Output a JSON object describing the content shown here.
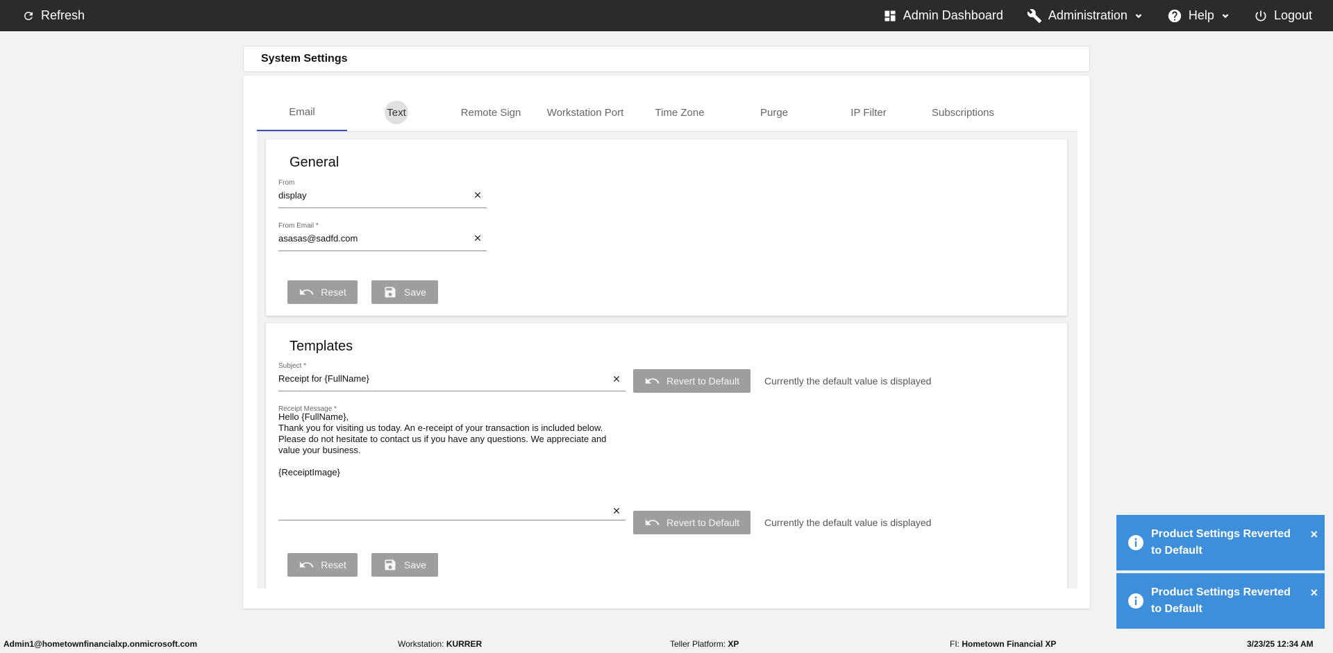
{
  "topbar": {
    "refresh_label": "Refresh",
    "admin_dashboard_label": "Admin Dashboard",
    "administration_label": "Administration",
    "help_label": "Help",
    "logout_label": "Logout"
  },
  "page_title": "System Settings",
  "tabs": [
    {
      "label": "Email"
    },
    {
      "label": "Text"
    },
    {
      "label": "Remote Sign"
    },
    {
      "label": "Workstation Port"
    },
    {
      "label": "Time Zone"
    },
    {
      "label": "Purge"
    },
    {
      "label": "IP Filter"
    },
    {
      "label": "Subscriptions"
    }
  ],
  "general": {
    "title": "General",
    "from_label": "From",
    "from_value": "display",
    "from_email_label": "From Email *",
    "from_email_value": "asasas@sadfd.com",
    "reset_label": "Reset",
    "save_label": "Save"
  },
  "templates": {
    "title": "Templates",
    "subject_label": "Subject *",
    "subject_value": "Receipt for {FullName}",
    "revert_label": "Revert to Default",
    "default_note": "Currently the default value is displayed",
    "message_label": "Receipt Message *",
    "message_value": "Hello {FullName},\nThank you for visiting us today. An e-receipt of your transaction is included below. Please do not hesitate to contact us if you have any questions. We appreciate and value your business.\n\n{ReceiptImage}",
    "revert_label_2": "Revert to Default",
    "default_note_2": "Currently the default value is displayed",
    "reset_label": "Reset",
    "save_label": "Save"
  },
  "toasts": [
    {
      "text": "Product Settings Reverted to Default",
      "close": "×"
    },
    {
      "text": "Product Settings Reverted to Default",
      "close": "×"
    }
  ],
  "footer": {
    "user": "Admin1@hometownfinancialxp.onmicrosoft.com",
    "workstation_label": "Workstation:",
    "workstation_value": "KURRER",
    "platform_label": "Teller Platform:",
    "platform_value": "XP",
    "fi_label": "FI:",
    "fi_value": "Hometown Financial XP",
    "datetime": "3/23/25 12:34 AM"
  },
  "colors": {
    "topbar_bg": "#2b2b2b",
    "active_tab_underline": "#3f51b5",
    "toast_bg": "#3d8fdc",
    "button_bg": "#9e9e9e"
  }
}
